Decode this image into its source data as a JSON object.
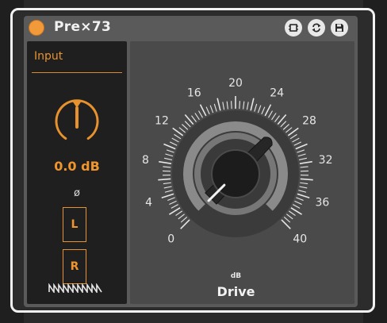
{
  "device": {
    "title": "Pre×73",
    "buttons": [
      {
        "name": "cpu-icon"
      },
      {
        "name": "hot-swap-icon"
      },
      {
        "name": "save-icon"
      }
    ]
  },
  "input": {
    "label": "Input",
    "gain_value": "0.0 dB",
    "phase_symbol": "ø",
    "left_label": "L",
    "right_label": "R"
  },
  "drive": {
    "label": "Drive",
    "unit": "dB",
    "scale_labels": [
      "0",
      "4",
      "8",
      "12",
      "16",
      "20",
      "24",
      "28",
      "32",
      "36",
      "40"
    ],
    "value_db": 0
  },
  "colors": {
    "accent": "#e8922e",
    "panel_dark": "#1f1f1f",
    "device_bg": "#5a5a5a",
    "frame": "#f2f2f2"
  }
}
